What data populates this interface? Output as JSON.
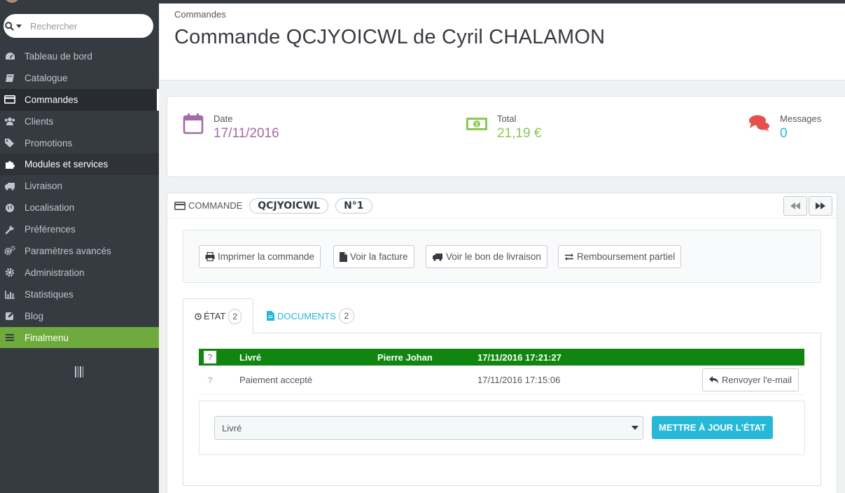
{
  "sidebar": {
    "search": {
      "placeholder": "Rechercher"
    },
    "items": [
      {
        "label": "Tableau de bord",
        "icon": "dashboard-icon",
        "state": "normal"
      },
      {
        "label": "Catalogue",
        "icon": "book-icon",
        "state": "normal"
      },
      {
        "label": "Commandes",
        "icon": "credit-card-icon",
        "state": "active"
      },
      {
        "label": "Clients",
        "icon": "users-icon",
        "state": "normal"
      },
      {
        "label": "Promotions",
        "icon": "tags-icon",
        "state": "normal"
      },
      {
        "label": "Modules et services",
        "icon": "puzzle-icon",
        "state": "hover"
      },
      {
        "label": "Livraison",
        "icon": "truck-icon",
        "state": "normal"
      },
      {
        "label": "Localisation",
        "icon": "globe-icon",
        "state": "normal"
      },
      {
        "label": "Préférences",
        "icon": "wrench-icon",
        "state": "normal"
      },
      {
        "label": "Paramètres avancés",
        "icon": "cogs-icon",
        "state": "normal"
      },
      {
        "label": "Administration",
        "icon": "cog-icon",
        "state": "normal"
      },
      {
        "label": "Statistiques",
        "icon": "bar-chart-icon",
        "state": "normal"
      },
      {
        "label": "Blog",
        "icon": "pencil-square-icon",
        "state": "normal"
      },
      {
        "label": "Finalmenu",
        "icon": "menu-lines-icon",
        "state": "green"
      }
    ]
  },
  "header": {
    "breadcrumb": "Commandes",
    "title": "Commande QCJYOICWL de Cyril CHALAMON"
  },
  "kpis": {
    "date": {
      "label": "Date",
      "value": "17/11/2016",
      "color": "#a569a8"
    },
    "total": {
      "label": "Total",
      "value": "21,19 €",
      "color": "#8bc954"
    },
    "messages": {
      "label": "Messages",
      "value": "0",
      "color": "#25b9d7"
    }
  },
  "order": {
    "heading": "COMMANDE",
    "reference": "QCJYOICWL",
    "number": "N°1",
    "actions": {
      "print": "Imprimer la commande",
      "invoice": "Voir la facture",
      "delivery": "Voir le bon de livraison",
      "refund": "Remboursement partiel"
    },
    "tabs": {
      "status": {
        "label": "ÉTAT",
        "count": "2"
      },
      "documents": {
        "label": "DOCUMENTS",
        "count": "2"
      }
    },
    "history": [
      {
        "mark": "?",
        "status": "Livré",
        "employee": "Pierre Johan",
        "date": "17/11/2016 17:21:27"
      },
      {
        "mark": "?",
        "status": "Paiement accepté",
        "employee": "",
        "date": "17/11/2016 17:15:06",
        "action": "Renvoyer l'e-mail"
      }
    ],
    "status_select": {
      "value": "Livré"
    },
    "update_button": "METTRE À JOUR L'ÉTAT"
  },
  "colors": {
    "sidebar_bg": "#363a41",
    "active_row": "#108510",
    "primary": "#25b9d7",
    "finalmenu": "#6fab3c"
  }
}
